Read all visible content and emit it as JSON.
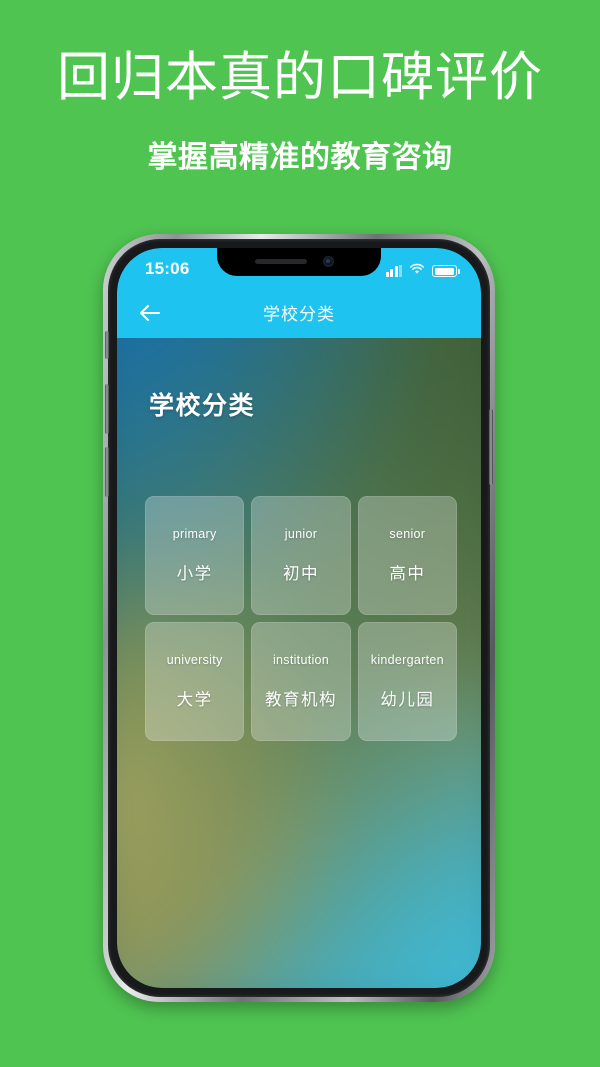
{
  "promo": {
    "headline": "回归本真的口碑评价",
    "subhead": "掌握高精准的教育咨询",
    "background_color": "#4fc451"
  },
  "phone": {
    "status_bar": {
      "time": "15:06",
      "signal_icon": "signal-bars-icon",
      "wifi_icon": "wifi-icon",
      "battery_icon": "battery-icon",
      "background_color": "#1fc3ef"
    },
    "nav_bar": {
      "back_icon": "back-arrow-icon",
      "title": "学校分类",
      "background_color": "#1fc3ef"
    },
    "page": {
      "heading": "学校分类",
      "cards": [
        {
          "en": "primary",
          "cn": "小学"
        },
        {
          "en": "junior",
          "cn": "初中"
        },
        {
          "en": "senior",
          "cn": "高中"
        },
        {
          "en": "university",
          "cn": "大学"
        },
        {
          "en": "institution",
          "cn": "教育机构"
        },
        {
          "en": "kindergarten",
          "cn": "幼儿园"
        }
      ]
    }
  }
}
